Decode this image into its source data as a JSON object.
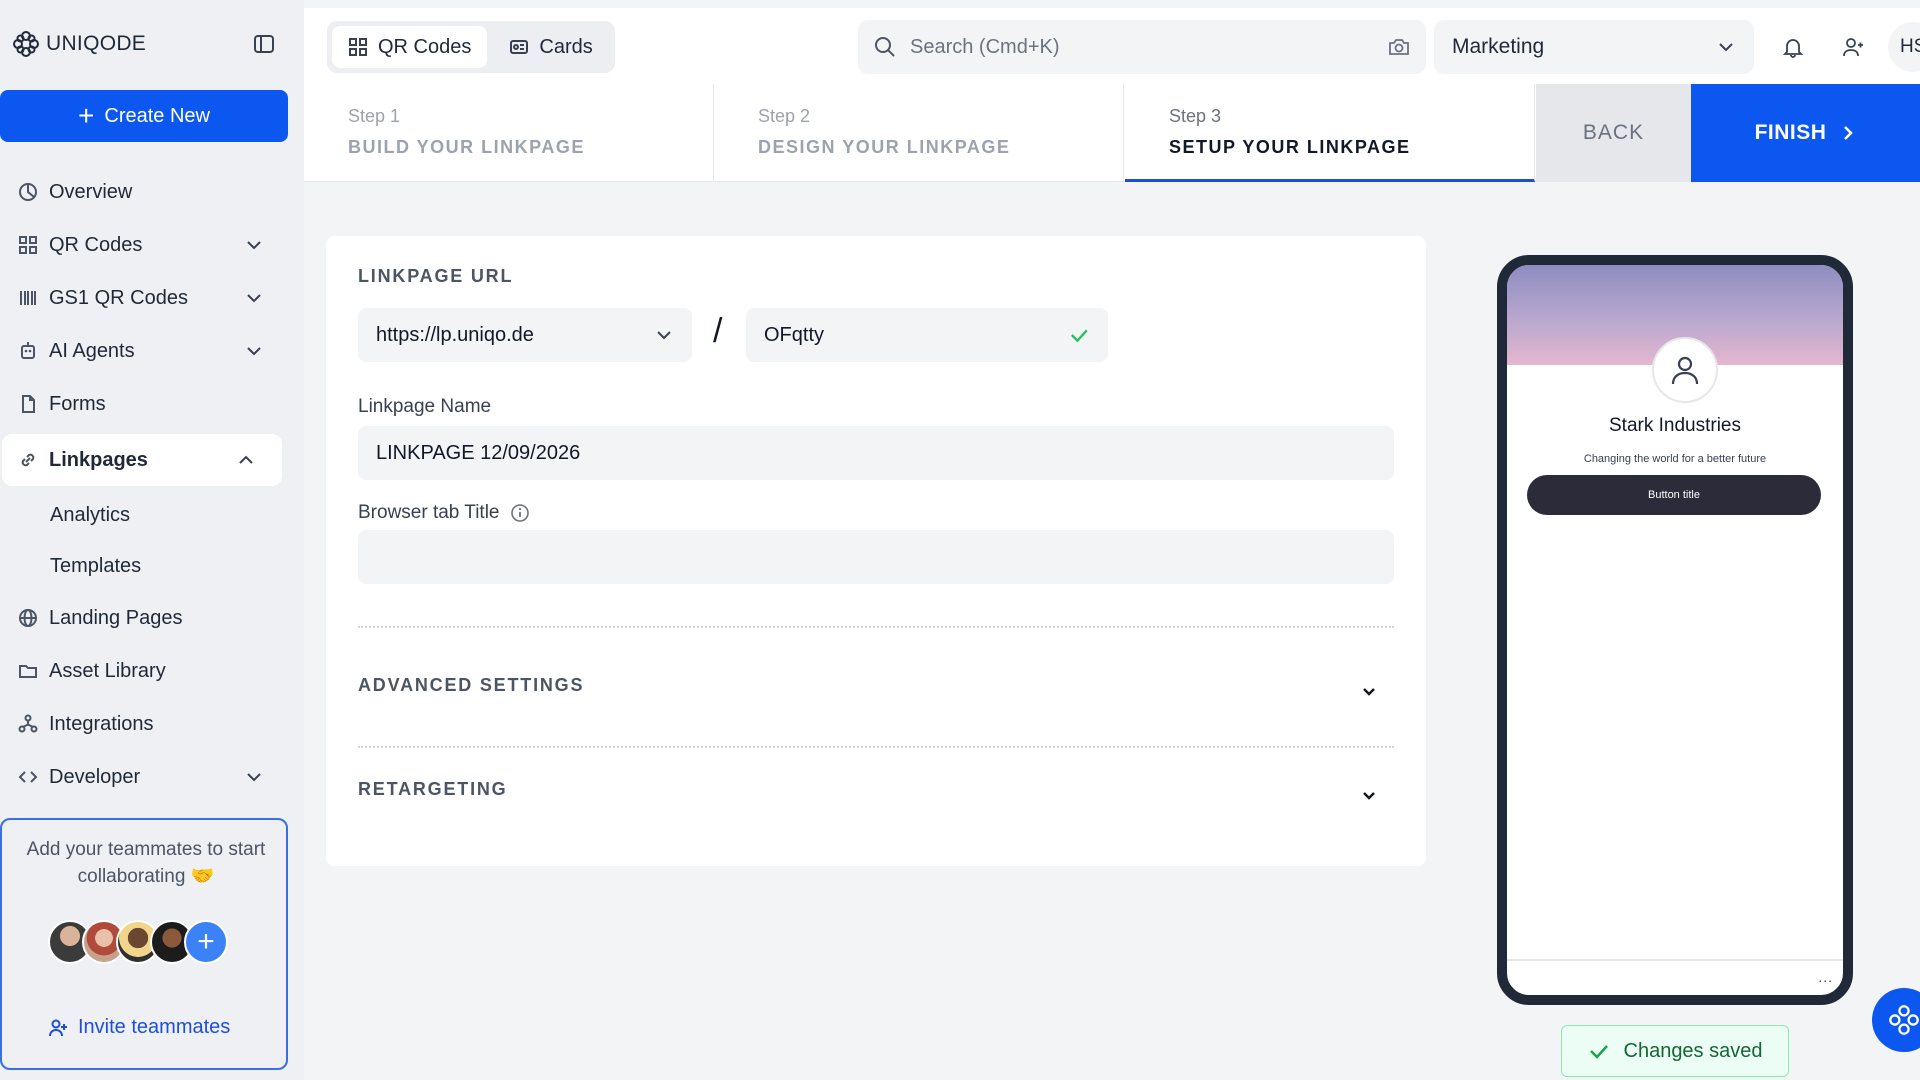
{
  "brand": {
    "name": "UNIQODE"
  },
  "sidebar": {
    "create_label": "Create New",
    "items": [
      {
        "label": "Overview",
        "icon": "chart-pie-icon"
      },
      {
        "label": "QR Codes",
        "icon": "qr-grid-icon"
      },
      {
        "label": "GS1 QR Codes",
        "icon": "barcode-icon"
      },
      {
        "label": "AI Agents",
        "icon": "robot-icon"
      },
      {
        "label": "Forms",
        "icon": "form-icon"
      },
      {
        "label": "Linkpages",
        "icon": "link-icon"
      },
      {
        "label": "Landing Pages",
        "icon": "globe-icon"
      },
      {
        "label": "Asset Library",
        "icon": "folder-icon"
      },
      {
        "label": "Integrations",
        "icon": "integration-icon"
      },
      {
        "label": "Developer",
        "icon": "code-icon"
      }
    ],
    "linkpages_sub": [
      {
        "label": "Analytics"
      },
      {
        "label": "Templates"
      }
    ],
    "team": {
      "text": "Add your teammates to start collaborating 🤝",
      "invite_label": "Invite teammates"
    }
  },
  "topbar": {
    "tabs": [
      {
        "label": "QR Codes"
      },
      {
        "label": "Cards"
      }
    ],
    "search_placeholder": "Search (Cmd+K)",
    "workspace": "Marketing",
    "user_initials": "HS"
  },
  "steps": [
    {
      "num": "Step 1",
      "title": "BUILD YOUR LINKPAGE"
    },
    {
      "num": "Step 2",
      "title": "DESIGN YOUR LINKPAGE"
    },
    {
      "num": "Step 3",
      "title": "SETUP YOUR LINKPAGE"
    }
  ],
  "actions": {
    "back": "BACK",
    "finish": "FINISH"
  },
  "form": {
    "url_label": "LINKPAGE URL",
    "domain": "https://lp.uniqo.de",
    "slash": "/",
    "slug": "OFqtty",
    "name_label": "Linkpage Name",
    "name_value": "LINKPAGE 12/09/2026",
    "browser_title_label": "Browser tab Title",
    "browser_title_value": "",
    "advanced_label": "ADVANCED SETTINGS",
    "retargeting_label": "RETARGETING"
  },
  "preview": {
    "company": "Stark Industries",
    "tagline": "Changing the world for a better future",
    "button": "Button title",
    "dots": "..."
  },
  "toast": {
    "text": "Changes saved"
  },
  "colors": {
    "primary": "#0b57f0",
    "success": "#22c55e"
  }
}
